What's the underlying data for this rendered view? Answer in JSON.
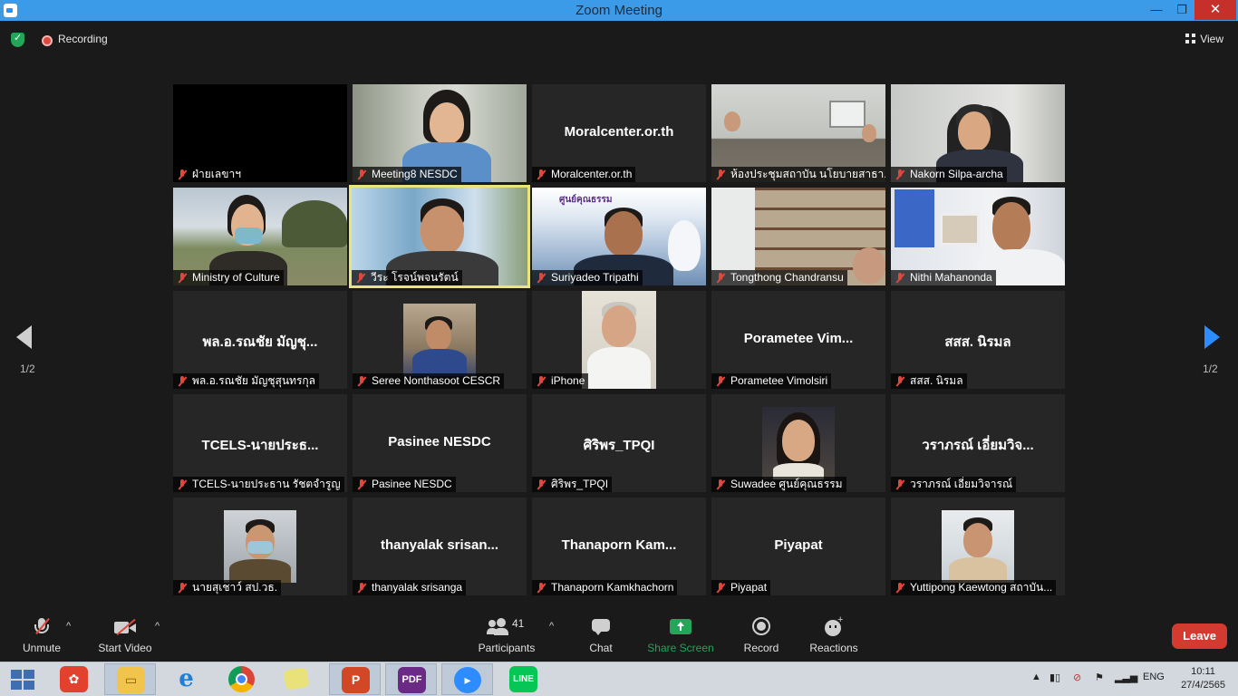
{
  "window": {
    "title": "Zoom Meeting",
    "minimize": "—",
    "restore": "❐",
    "close": "✕"
  },
  "topbar": {
    "recording_label": "Recording",
    "view_label": "View"
  },
  "pager": {
    "left": "1/2",
    "right": "1/2"
  },
  "tiles": [
    {
      "name": "ฝ่ายเลขาฯ",
      "center": ""
    },
    {
      "name": "Meeting8 NESDC",
      "center": ""
    },
    {
      "name": "Moralcenter.or.th",
      "center": "Moralcenter.or.th"
    },
    {
      "name": "ห้องประชุมสถาบัน นโยบายสาธา...",
      "center": ""
    },
    {
      "name": "Nakorn Silpa-archa",
      "center": ""
    },
    {
      "name": "Ministry of Culture",
      "center": ""
    },
    {
      "name": "วีระ โรจน์พจนรัตน์",
      "center": ""
    },
    {
      "name": "Suriyadeo Tripathi",
      "center": ""
    },
    {
      "name": "Tongthong Chandransu",
      "center": ""
    },
    {
      "name": "Nithi Mahanonda",
      "center": ""
    },
    {
      "name": "พล.อ.รณชัย มัญชุสุนทรกุล",
      "center": "พล.อ.รณชัย มัญชุ..."
    },
    {
      "name": "Seree Nonthasoot CESCR",
      "center": ""
    },
    {
      "name": "iPhone",
      "center": ""
    },
    {
      "name": "Porametee Vimolsiri",
      "center": "Porametee  Vim..."
    },
    {
      "name": "สสส. นิรมล",
      "center": "สสส. นิรมล"
    },
    {
      "name": "TCELS-นายประธาน รัชตจำรูญ",
      "center": "TCELS-นายประธ..."
    },
    {
      "name": "Pasinee NESDC",
      "center": "Pasinee NESDC"
    },
    {
      "name": "ศิริพร_TPQI",
      "center": "ศิริพร_TPQI"
    },
    {
      "name": "Suwadee ศูนย์คุณธรรม",
      "center": ""
    },
    {
      "name": "วราภรณ์ เอี่ยมวิจารณ์",
      "center": "วราภรณ์ เอี่ยมวิจ..."
    },
    {
      "name": "นายสุเชาว์ สป.วธ.",
      "center": ""
    },
    {
      "name": "thanyalak srisanga",
      "center": "thanyalak  srisan..."
    },
    {
      "name": "Thanaporn Kamkhachorn",
      "center": "Thanaporn  Kam..."
    },
    {
      "name": "Piyapat",
      "center": "Piyapat"
    },
    {
      "name": "Yuttipong Kaewtong สถาบัน...",
      "center": ""
    }
  ],
  "tile_text": {
    "moral_banner": "ศูนย์คุณธรรม"
  },
  "toolbar": {
    "unmute": "Unmute",
    "start_video": "Start Video",
    "participants": "Participants",
    "participants_count": "41",
    "chat": "Chat",
    "share_screen": "Share Screen",
    "record": "Record",
    "reactions": "Reactions",
    "leave": "Leave"
  },
  "taskbar": {
    "apps": [
      "Foxit",
      "File Explorer",
      "Internet Explorer",
      "Chrome",
      "Sticky Notes",
      "PowerPoint",
      "PDF",
      "Zoom",
      "LINE"
    ],
    "line_label": "LINE",
    "lang": "ENG",
    "time": "10:11",
    "date": "27/4/2565"
  },
  "colors": {
    "accent": "#2d8cff",
    "leave": "#d33b30",
    "share": "#23a55a",
    "active_speaker": "#e9e57c"
  }
}
